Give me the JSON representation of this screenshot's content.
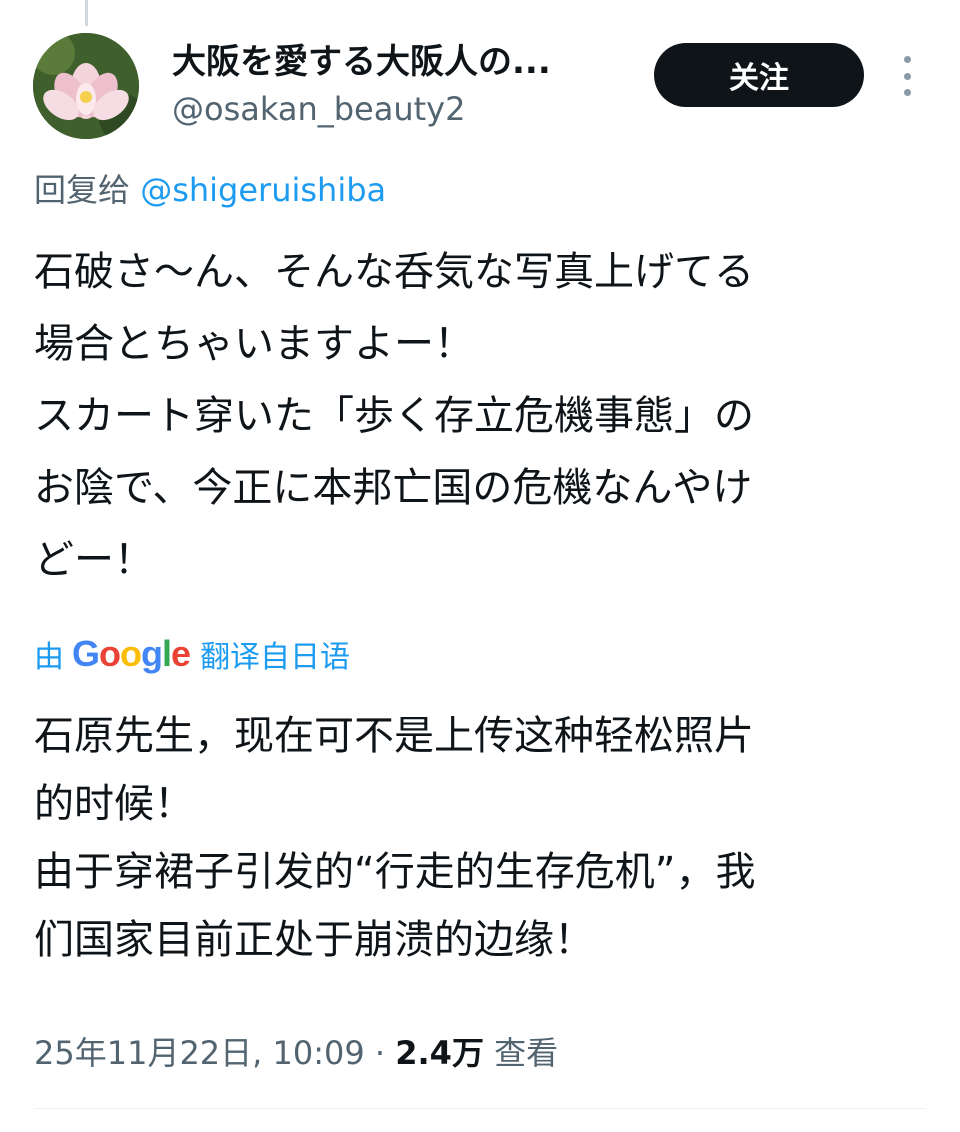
{
  "author": {
    "display_name": "大阪を愛する大阪人の...",
    "handle": "@osakan_beauty2",
    "avatar_icon": "lotus-flower-avatar"
  },
  "header": {
    "follow_label": "关注",
    "more_icon": "vertical-ellipsis-icon"
  },
  "reply": {
    "prefix": "回复给",
    "mention": "@shigeruishiba"
  },
  "tweet": {
    "text": "石破さ〜ん、そんな呑気な写真上げてる\n場合とちゃいますよー！\nスカート穿いた「歩く存立危機事態」の\nお陰で、今正に本邦亡国の危機なんやけ\nどー！"
  },
  "translation": {
    "prefix": "由",
    "provider": "Google",
    "suffix": "翻译自日语",
    "text": "石原先生，现在可不是上传这种轻松照片\n的时候！\n由于穿裙子引发的“行走的生存危机”，我\n们国家目前正处于崩溃的边缘！"
  },
  "meta": {
    "timestamp": "25年11月22日, 10:09",
    "separator": "·",
    "views_count": "2.4万",
    "views_label": "查看"
  },
  "colors": {
    "text_primary": "#0f1419",
    "text_secondary": "#536471",
    "link": "#1d9bf0",
    "follow_bg": "#0f1419"
  }
}
